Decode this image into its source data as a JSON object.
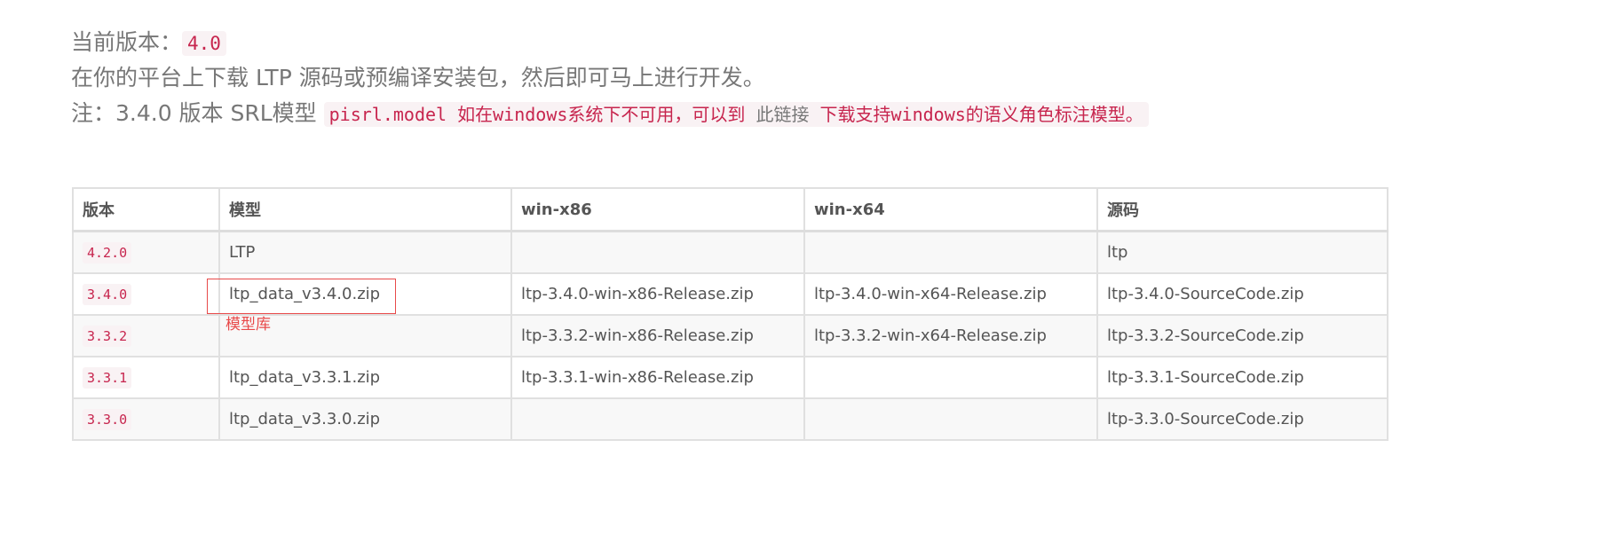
{
  "intro": {
    "current_version_label": "当前版本：",
    "current_version_value": "4.0",
    "download_text": "在你的平台上下载 LTP 源码或预编译安装包，然后即可马上进行开发。",
    "note_prefix": "注：3.4.0 版本 SRL模型 ",
    "note_code": "pisrl.model 如在windows系统下不可用，可以到",
    "note_link": " 此链接 ",
    "note_suffix": "下载支持windows的语义角色标注模型。"
  },
  "table": {
    "headers": [
      "版本",
      "模型",
      "win-x86",
      "win-x64",
      "源码"
    ],
    "rows": [
      {
        "version": "4.2.0",
        "model": "LTP",
        "x86": "",
        "x64": "",
        "source": "ltp"
      },
      {
        "version": "3.4.0",
        "model": "ltp_data_v3.4.0.zip",
        "x86": "ltp-3.4.0-win-x86-Release.zip",
        "x64": "ltp-3.4.0-win-x64-Release.zip",
        "source": "ltp-3.4.0-SourceCode.zip"
      },
      {
        "version": "3.3.2",
        "model": "",
        "x86": "ltp-3.3.2-win-x86-Release.zip",
        "x64": "ltp-3.3.2-win-x64-Release.zip",
        "source": "ltp-3.3.2-SourceCode.zip"
      },
      {
        "version": "3.3.1",
        "model": "ltp_data_v3.3.1.zip",
        "x86": "ltp-3.3.1-win-x86-Release.zip",
        "x64": "",
        "source": "ltp-3.3.1-SourceCode.zip"
      },
      {
        "version": "3.3.0",
        "model": "ltp_data_v3.3.0.zip",
        "x86": "",
        "x64": "",
        "source": "ltp-3.3.0-SourceCode.zip"
      }
    ]
  },
  "annotation": {
    "label": "模型库",
    "color": "#e84a4a"
  }
}
